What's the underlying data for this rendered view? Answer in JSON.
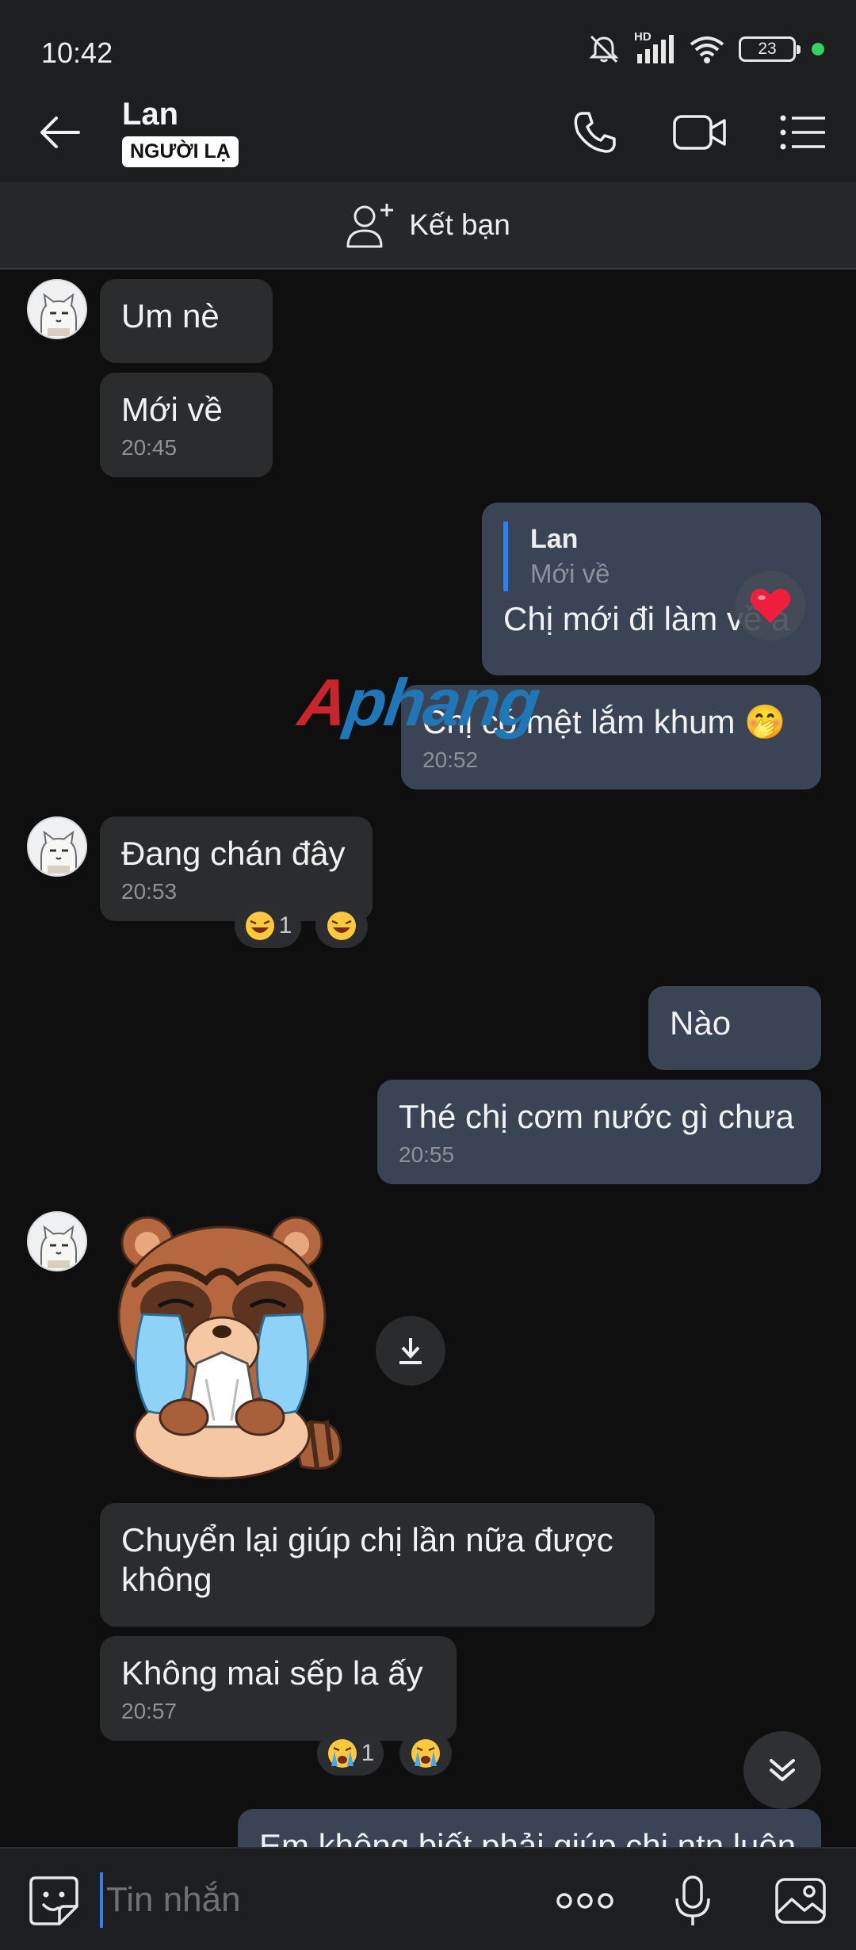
{
  "status_bar": {
    "time": "10:42",
    "network_label": "HD",
    "battery": "23"
  },
  "header": {
    "name": "Lan",
    "badge": "NGƯỜI LẠ"
  },
  "add_friend": {
    "label": "Kết bạn"
  },
  "messages": [
    {
      "dir": "in",
      "text": "Um nè"
    },
    {
      "dir": "in",
      "text": "Mới về",
      "time": "20:45"
    },
    {
      "dir": "out",
      "reply_to": {
        "name": "Lan",
        "text": "Mới về"
      },
      "text": "Chị mới đi làm về à",
      "reaction": "heart"
    },
    {
      "dir": "out",
      "text": "Chị có mệt lắm khum 🤭",
      "time": "20:52"
    },
    {
      "dir": "in",
      "text": "Đang chán đây",
      "time": "20:53",
      "reactions": [
        {
          "emoji": "laugh",
          "count": "1"
        }
      ]
    },
    {
      "dir": "out",
      "text": "Nào"
    },
    {
      "dir": "out",
      "text": "Thé chị cơm nước gì chưa",
      "time": "20:55"
    },
    {
      "dir": "in",
      "type": "sticker",
      "sticker_name": "crying-raccoon"
    },
    {
      "dir": "in",
      "text": "Chuyển lại giúp chị lần nữa được không"
    },
    {
      "dir": "in",
      "text": "Không mai sếp la ấy",
      "time": "20:57",
      "reactions": [
        {
          "emoji": "crying",
          "count": "1"
        }
      ]
    },
    {
      "dir": "out",
      "text": "Em không biết phải giúp chị ntn luôn",
      "partial": true
    }
  ],
  "watermark": {
    "part1": "A",
    "part2": "phang"
  },
  "input": {
    "placeholder": "Tin nhắn"
  },
  "colors": {
    "background": "#0f0f10",
    "bar": "#1d1e20",
    "bubble_in": "#2b2c2e",
    "bubble_out": "#3a4454",
    "accent": "#2f80ed"
  }
}
